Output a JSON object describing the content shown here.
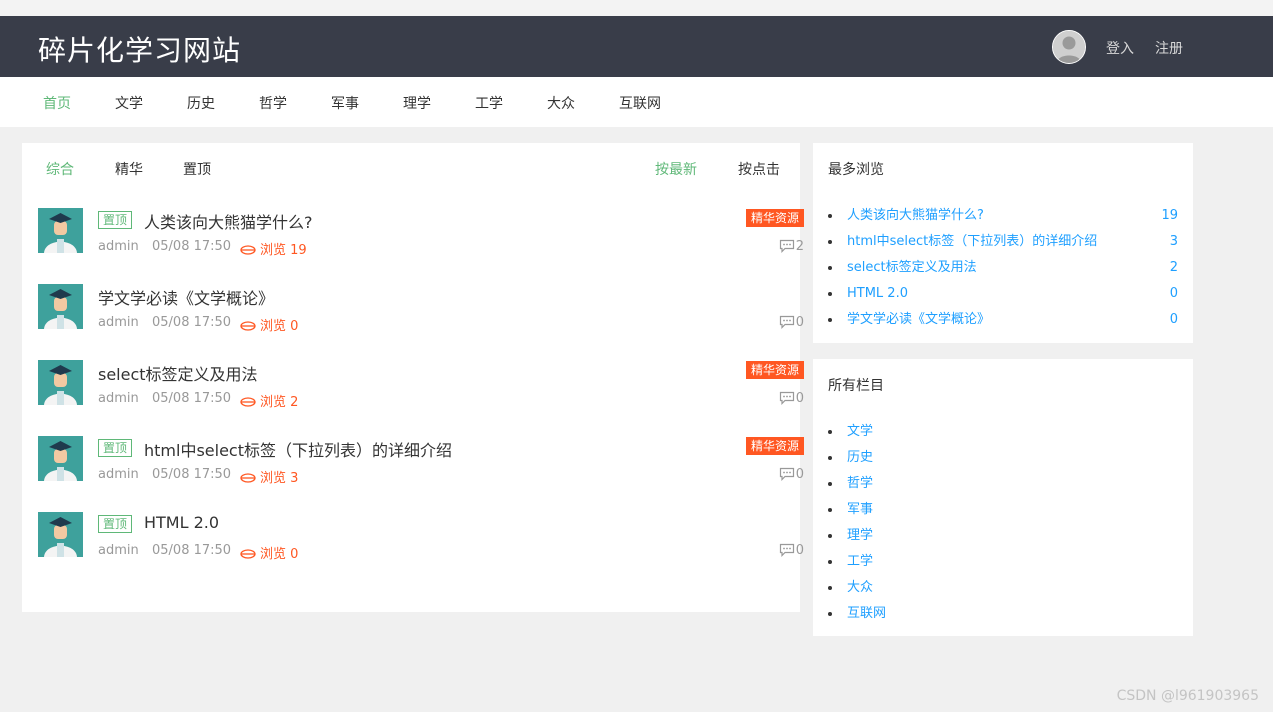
{
  "header": {
    "logo": "碎片化学习网站",
    "login": "登入",
    "register": "注册"
  },
  "nav": {
    "items": [
      "首页",
      "文学",
      "历史",
      "哲学",
      "军事",
      "理学",
      "工学",
      "大众",
      "互联网"
    ]
  },
  "tabs": {
    "all": "综合",
    "essence": "精华",
    "top": "置顶",
    "latest": "按最新",
    "clicks": "按点击"
  },
  "posts": [
    {
      "top_tag": "置顶",
      "title": "人类该向大熊猫学什么?",
      "essence": "精华资源",
      "author": "admin",
      "time": "05/08 17:50",
      "views": "浏览 19",
      "comments": "2"
    },
    {
      "title": "学文学必读《文学概论》",
      "author": "admin",
      "time": "05/08 17:50",
      "views": "浏览 0",
      "comments": "0"
    },
    {
      "title": "select标签定义及用法",
      "essence": "精华资源",
      "author": "admin",
      "time": "05/08 17:50",
      "views": "浏览 2",
      "comments": "0"
    },
    {
      "top_tag": "置顶",
      "title": "html中select标签（下拉列表）的详细介绍",
      "essence": "精华资源",
      "author": "admin",
      "time": "05/08 17:50",
      "views": "浏览 3",
      "comments": "0"
    },
    {
      "top_tag": "置顶",
      "title": "HTML 2.0",
      "author": "admin",
      "time": "05/08 17:50",
      "views": "浏览 0",
      "comments": "0"
    }
  ],
  "most_viewed": {
    "title": "最多浏览",
    "items": [
      {
        "label": "人类该向大熊猫学什么?",
        "count": "19"
      },
      {
        "label": "html中select标签（下拉列表）的详细介绍",
        "count": "3"
      },
      {
        "label": "select标签定义及用法",
        "count": "2"
      },
      {
        "label": "HTML 2.0",
        "count": "0"
      },
      {
        "label": "学文学必读《文学概论》",
        "count": "0"
      }
    ]
  },
  "categories": {
    "title": "所有栏目",
    "items": [
      "文学",
      "历史",
      "哲学",
      "军事",
      "理学",
      "工学",
      "大众",
      "互联网"
    ]
  },
  "watermark": "CSDN @l961903965",
  "colors": {
    "header_bg": "#393d49",
    "accent_green": "#5fb878",
    "accent_orange": "#ff5722",
    "link_blue": "#1e9fff"
  }
}
